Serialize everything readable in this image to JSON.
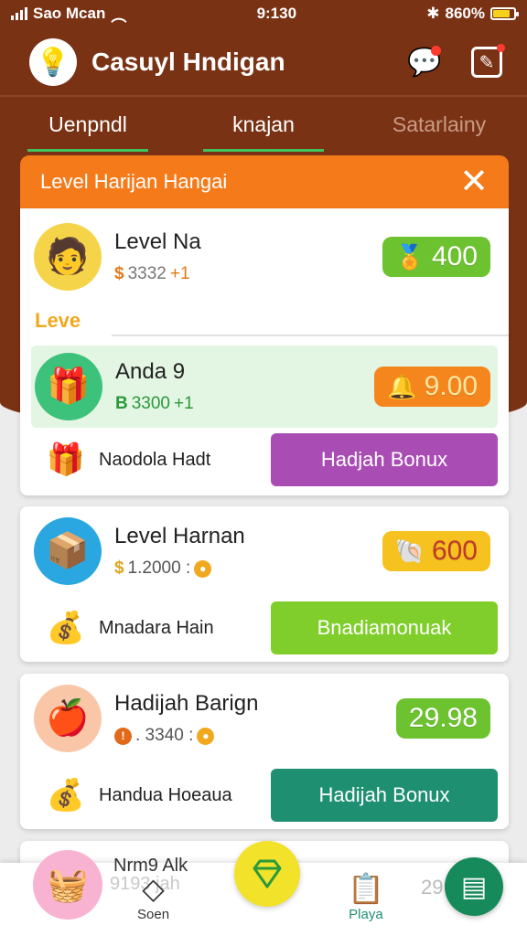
{
  "status_bar": {
    "carrier": "Sao Mcan",
    "time": "9:130",
    "battery": "860%"
  },
  "header": {
    "app_title": "Casuyl Hndigan",
    "logo_icon": "lightbulb-icon",
    "chat_icon": "chat-icon",
    "edit_icon": "edit-icon"
  },
  "tabs": [
    {
      "label": "Uenpndl"
    },
    {
      "label": "knajan"
    },
    {
      "label": "Satarlainy"
    }
  ],
  "banner": {
    "title": "Level Harijan Hangai",
    "close_label": "✕"
  },
  "card1": {
    "row1": {
      "name": "Level Na",
      "currency": "$",
      "amount": "3332",
      "bonus": "+1",
      "reward": "400"
    },
    "section_tag": "Leve",
    "row2": {
      "name": "Anda 9",
      "currency": "B",
      "amount": "3300",
      "bonus": "+1",
      "reward": "9.00"
    },
    "bottom_label": "Naodola Hadt",
    "button_label": "Hadjah Bonux"
  },
  "card2": {
    "name": "Level Harnan",
    "currency": "$",
    "amount": "1.2000 :",
    "reward": "600",
    "bottom_label": "Mnadara Hain",
    "button_label": "Bnadiamonuak"
  },
  "card3": {
    "name": "Hadijah Barign",
    "currency": "",
    "amount": ". 3340 :",
    "reward": "29.98",
    "bottom_label": "Handua Hoeaua",
    "button_label": "Hadijah Bonux"
  },
  "card4": {
    "name": "Nrm9 Alk",
    "amount": "9193 jah"
  },
  "bottom_nav": {
    "item1": "Soen",
    "item2": "Playa",
    "peek_value": "29"
  },
  "colors": {
    "hero_bg": "#7a3214",
    "banner": "#f57a1a",
    "purple_button": "#a94db4",
    "lime_button": "#7fce2b",
    "teal_button": "#1f8f72",
    "green_pill": "#6cc22f",
    "orange_pill": "#f5861e",
    "yellow_pill": "#f5c21f"
  }
}
